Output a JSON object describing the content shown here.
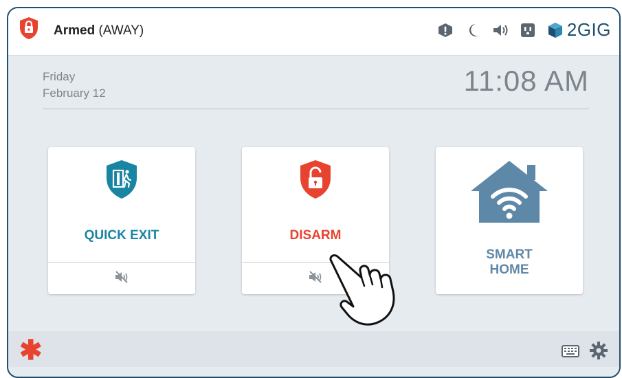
{
  "status": {
    "armed_label": "Armed",
    "mode_label": "(AWAY)",
    "shield_color": "#e8432e"
  },
  "top_icons": [
    "alert-icon",
    "moon-icon",
    "volume-icon",
    "outlet-icon"
  ],
  "brand": {
    "name": "2GIG",
    "color": "#1f4e6e"
  },
  "date": {
    "day": "Friday",
    "date": "February 12"
  },
  "clock": {
    "time": "11:08 AM"
  },
  "cards": [
    {
      "label": "QUICK EXIT",
      "color": "#1a85a3",
      "icon": "quick-exit-shield-icon",
      "sub_icon": "mute-icon"
    },
    {
      "label": "DISARM",
      "color": "#e8432e",
      "icon": "unlock-shield-icon",
      "sub_icon": "mute-icon"
    },
    {
      "label_line1": "SMART",
      "label_line2": "HOME",
      "color": "#5e88a8",
      "icon": "smart-home-icon"
    }
  ],
  "bottom": {
    "emergency_icon": "asterisk-icon",
    "keyboard_icon": "keyboard-icon",
    "settings_icon": "gear-icon",
    "emergency_color": "#e8432e"
  }
}
